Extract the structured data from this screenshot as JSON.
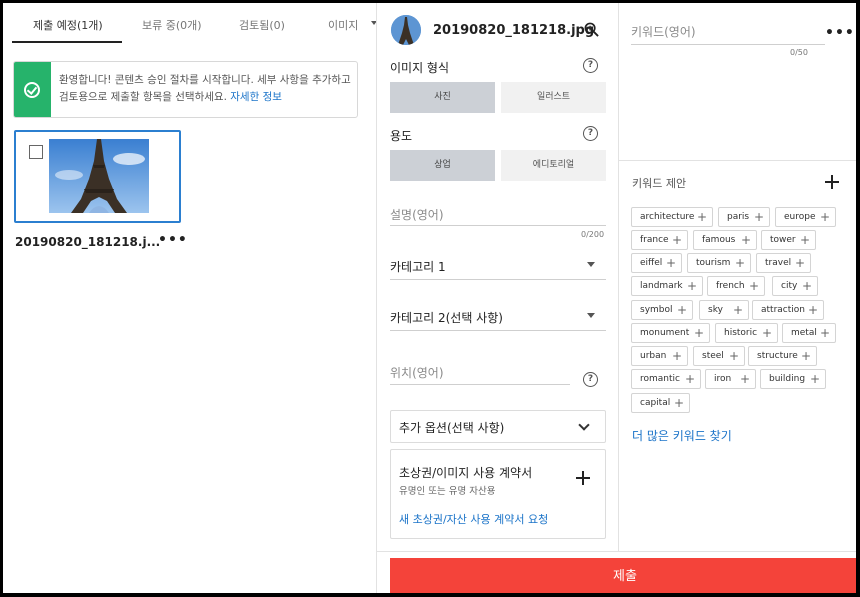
{
  "tabs": [
    {
      "label": "제출 예정(1개)"
    },
    {
      "label": "보류 중(0개)"
    },
    {
      "label": "검토됨(0)"
    },
    {
      "label": "이미지"
    }
  ],
  "banner": {
    "text": "환영합니다! 콘텐츠 승인 절차를 시작합니다. 세부 사항을 추가하고 검토용으로 제출할 항목을 선택하세요.",
    "link": "자세한 정보",
    "color": "#26b36b"
  },
  "file": {
    "name_truncated": "20190820_181218.j...",
    "name": "20190820_181218.jpg"
  },
  "image_type": {
    "label": "이미지 형식",
    "options": [
      "사진",
      "일러스트"
    ],
    "selected": "사진"
  },
  "usage": {
    "label": "용도",
    "options": [
      "상업",
      "에디토리얼"
    ],
    "selected": "상업"
  },
  "description": {
    "placeholder": "설명(영어)",
    "counter": "0/200"
  },
  "category1": {
    "label": "카테고리 1"
  },
  "category2": {
    "label": "카테고리 2(선택 사항)"
  },
  "location": {
    "placeholder": "위치(영어)"
  },
  "extra_options": {
    "label": "추가 옵션(선택 사항)"
  },
  "release": {
    "title": "초상권/이미지 사용 계약서",
    "subtitle": "유명인 또는 유명 자산용",
    "link": "새 초상권/자산 사용 계약서 요청"
  },
  "keywords": {
    "placeholder": "키워드(영어)",
    "counter": "0/50",
    "suggest_label": "키워드 제안",
    "more_link": "더 많은 키워드 찾기",
    "suggestions": [
      "architecture",
      "paris",
      "europe",
      "france",
      "famous",
      "tower",
      "eiffel",
      "tourism",
      "travel",
      "landmark",
      "french",
      "city",
      "symbol",
      "sky",
      "attraction",
      "monument",
      "historic",
      "metal",
      "urban",
      "steel",
      "structure",
      "romantic",
      "iron",
      "building",
      "capital"
    ]
  },
  "submit": {
    "label": "제출",
    "color": "#f4433a"
  },
  "icons": {
    "success": "check-circle-icon",
    "zoom": "zoom-in-icon",
    "help": "help-circle-icon",
    "more": "more-horizontal-icon",
    "add": "plus-icon",
    "dropdown": "caret-down-icon"
  }
}
